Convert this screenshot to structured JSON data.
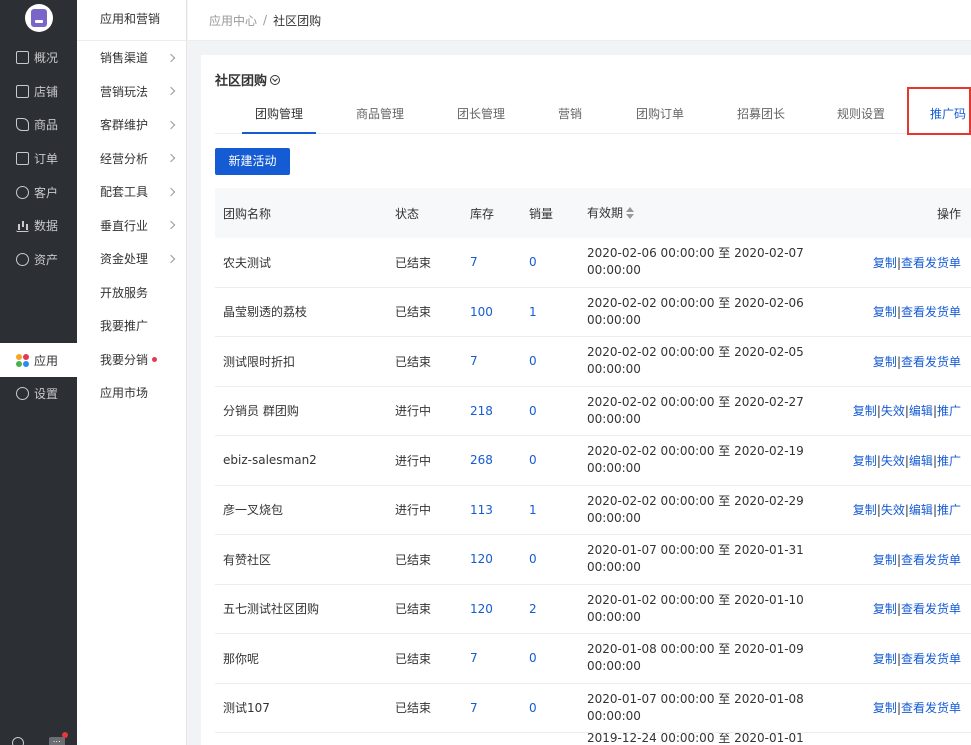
{
  "rail": {
    "items": [
      {
        "label": "概况",
        "icon": "monitor-icon"
      },
      {
        "label": "店铺",
        "icon": "store-icon"
      },
      {
        "label": "商品",
        "icon": "tag-icon"
      },
      {
        "label": "订单",
        "icon": "document-icon"
      },
      {
        "label": "客户",
        "icon": "user-icon"
      },
      {
        "label": "数据",
        "icon": "bar-chart-icon"
      },
      {
        "label": "资产",
        "icon": "yen-circle-icon"
      }
    ],
    "active": {
      "label": "应用",
      "icon": "apps-icon"
    },
    "settings": {
      "label": "设置",
      "icon": "gear-icon"
    }
  },
  "subnav": {
    "title": "应用和营销",
    "items": [
      {
        "label": "销售渠道"
      },
      {
        "label": "营销玩法"
      },
      {
        "label": "客群维护"
      },
      {
        "label": "经营分析"
      },
      {
        "label": "配套工具"
      },
      {
        "label": "垂直行业"
      },
      {
        "label": "资金处理"
      },
      {
        "label": "开放服务"
      },
      {
        "label": "我要推广"
      },
      {
        "label": "我要分销"
      },
      {
        "label": "应用市场"
      }
    ]
  },
  "breadcrumb": {
    "parent": "应用中心",
    "sep": "/",
    "current": "社区团购"
  },
  "page": {
    "title": "社区团购"
  },
  "tabs": [
    "团购管理",
    "商品管理",
    "团长管理",
    "营销",
    "团购订单",
    "招募团长",
    "规则设置",
    "推广码"
  ],
  "new_button": "新建活动",
  "table": {
    "headers": {
      "name": "团购名称",
      "status": "状态",
      "stock": "库存",
      "sales": "销量",
      "validity": "有效期",
      "ops": "操作"
    },
    "rows": [
      {
        "name": "农夫测试",
        "status": "已结束",
        "stock": "7",
        "sales": "0",
        "start": "2020-02-06 00:00:00 至 2020-02-07",
        "end": "00:00:00",
        "ops": [
          "复制",
          "查看发货单"
        ]
      },
      {
        "name": "晶莹剔透的荔枝",
        "status": "已结束",
        "stock": "100",
        "sales": "1",
        "start": "2020-02-02 00:00:00 至 2020-02-06",
        "end": "00:00:00",
        "ops": [
          "复制",
          "查看发货单"
        ]
      },
      {
        "name": "测试限时折扣",
        "status": "已结束",
        "stock": "7",
        "sales": "0",
        "start": "2020-02-02 00:00:00 至 2020-02-05",
        "end": "00:00:00",
        "ops": [
          "复制",
          "查看发货单"
        ]
      },
      {
        "name": "分销员 群团购",
        "status": "进行中",
        "stock": "218",
        "sales": "0",
        "start": "2020-02-02 00:00:00 至 2020-02-27",
        "end": "00:00:00",
        "ops": [
          "复制",
          "失效",
          "编辑",
          "推广"
        ]
      },
      {
        "name": "ebiz-salesman2",
        "status": "进行中",
        "stock": "268",
        "sales": "0",
        "start": "2020-02-02 00:00:00 至 2020-02-19",
        "end": "00:00:00",
        "ops": [
          "复制",
          "失效",
          "编辑",
          "推广"
        ]
      },
      {
        "name": "彦一叉烧包",
        "status": "进行中",
        "stock": "113",
        "sales": "1",
        "start": "2020-02-02 00:00:00 至 2020-02-29",
        "end": "00:00:00",
        "ops": [
          "复制",
          "失效",
          "编辑",
          "推广"
        ]
      },
      {
        "name": "有赞社区",
        "status": "已结束",
        "stock": "120",
        "sales": "0",
        "start": "2020-01-07 00:00:00 至 2020-01-31",
        "end": "00:00:00",
        "ops": [
          "复制",
          "查看发货单"
        ]
      },
      {
        "name": "五七测试社区团购",
        "status": "已结束",
        "stock": "120",
        "sales": "2",
        "start": "2020-01-02 00:00:00 至 2020-01-10",
        "end": "00:00:00",
        "ops": [
          "复制",
          "查看发货单"
        ]
      },
      {
        "name": "那你呢",
        "status": "已结束",
        "stock": "7",
        "sales": "0",
        "start": "2020-01-08 00:00:00 至 2020-01-09",
        "end": "00:00:00",
        "ops": [
          "复制",
          "查看发货单"
        ]
      },
      {
        "name": "测试107",
        "status": "已结束",
        "stock": "7",
        "sales": "0",
        "start": "2020-01-07 00:00:00 至 2020-01-08",
        "end": "00:00:00",
        "ops": [
          "复制",
          "查看发货单"
        ]
      }
    ],
    "partial_row": {
      "start": "2019-12-24 00:00:00 至 2020-01-01"
    }
  },
  "colors": {
    "accent": "#155bd4",
    "rail_bg": "#2c2f33",
    "highlight_border": "#e5372e",
    "badge_red": "#e53950"
  }
}
